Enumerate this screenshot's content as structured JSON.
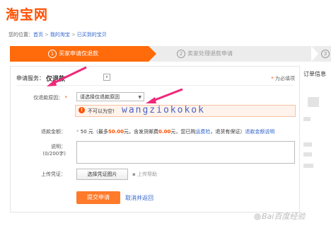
{
  "logo": "淘宝网",
  "breadcrumb": {
    "prefix": "您的位置：",
    "items": [
      "首页",
      "我的淘宝",
      "已买到的宝贝"
    ],
    "separator": ">"
  },
  "steps": [
    {
      "num": "1",
      "label": "买家申请仅退款"
    },
    {
      "num": "2",
      "label": "卖家处理退款申请"
    },
    {
      "num": "3",
      "label": ""
    }
  ],
  "form": {
    "service_label": "申请服务：",
    "service_value": "仅退款",
    "required_note": "为必填项",
    "reason_label": "仅退款原因：",
    "reason_select": "请选择仅退款原因",
    "alert_text": "不可以为空!",
    "amount_label": "退款金额：",
    "amount_text": {
      "a": "50",
      "b": "元（最多",
      "c": "50.00",
      "d": "元，含发货邮费",
      "e": "0.00",
      "f": "元，您已购",
      "g": "运费险",
      "h": "，退货有保证）",
      "i": "退款金额说明"
    },
    "desc_label": "说明：",
    "desc_limit": "(0/200字)",
    "upload_label": "上传凭证：",
    "upload_button": "选择凭证图片",
    "help_link": "上传帮助",
    "submit": "提交申请",
    "cancel": "取消并返回"
  },
  "watermark": "wangziokokok",
  "sidebar": {
    "title": "订单信息"
  },
  "footer_watermark": "Bai百度经验",
  "colors": {
    "brand": "#ff5000",
    "link": "#3366cc",
    "step_active": "#ff6a0a"
  }
}
